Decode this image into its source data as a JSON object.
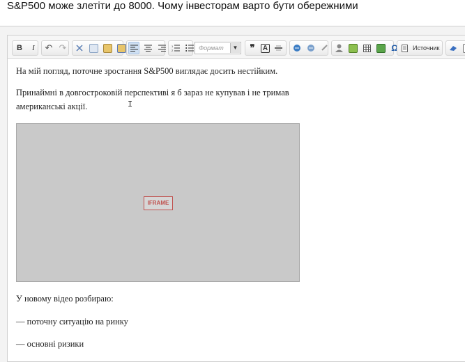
{
  "title": {
    "value": "S&P500 може злетіти до 8000. Чому інвесторам варто бути обережними"
  },
  "toolbar": {
    "bold": "B",
    "italic": "I",
    "undo_icon": "↶",
    "redo_icon": "↷",
    "format_placeholder": "Формат",
    "format_dropdown_icon": "▼",
    "blockquote": "❞",
    "textcolor": "A",
    "source_label": "Источник"
  },
  "content": {
    "p1": "На мій погляд, поточне зростання S&P500 виглядає досить нестійким.",
    "p2_line1": "Принаймні в довгостроковій перспективі я б зараз не купував і не тримав",
    "p2_line2": "американські акції.",
    "iframe_label": "IFRAME",
    "p3": "У новому відео розбираю:",
    "p4": "— поточну ситуацію на ринку",
    "p5": "— основні ризики",
    "cursor": "I"
  }
}
